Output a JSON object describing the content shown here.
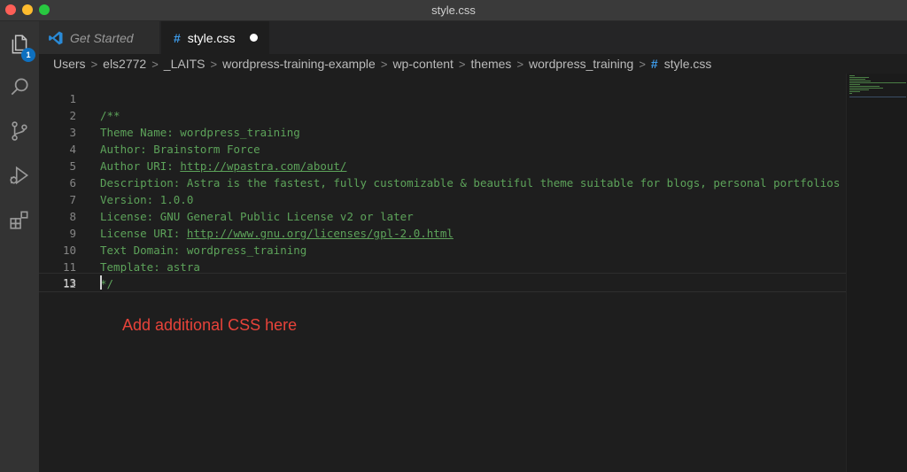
{
  "window": {
    "title": "style.css"
  },
  "activity_bar": {
    "explorer_badge": "1",
    "items": [
      {
        "icon": "files-icon"
      },
      {
        "icon": "search-icon"
      },
      {
        "icon": "source-control-icon"
      },
      {
        "icon": "run-debug-icon"
      },
      {
        "icon": "extensions-icon"
      }
    ]
  },
  "tabs": [
    {
      "label": "Get Started",
      "icon": "vscode-logo-icon",
      "active": false
    },
    {
      "label": "style.css",
      "icon": "css-hash-icon",
      "active": true,
      "modified": true
    }
  ],
  "breadcrumb": {
    "items": [
      "Users",
      "els2772",
      "_LAITS",
      "wordpress-training-example",
      "wp-content",
      "themes",
      "wordpress_training"
    ],
    "file": "style.css"
  },
  "editor": {
    "lines": [
      {
        "num": "1",
        "text": "/**"
      },
      {
        "num": "2",
        "text": "Theme Name: wordpress_training"
      },
      {
        "num": "3",
        "text": "Author: Brainstorm Force"
      },
      {
        "num": "4",
        "prefix": "Author URI: ",
        "link": "http://wpastra.com/about/"
      },
      {
        "num": "5",
        "text": "Description: Astra is the fastest, fully customizable & beautiful theme suitable for blogs, personal portfolios"
      },
      {
        "num": "6",
        "text": "Version: 1.0.0"
      },
      {
        "num": "7",
        "text": "License: GNU General Public License v2 or later"
      },
      {
        "num": "8",
        "prefix": "License URI: ",
        "link": "http://www.gnu.org/licenses/gpl-2.0.html"
      },
      {
        "num": "9",
        "text": "Text Domain: wordpress_training"
      },
      {
        "num": "10",
        "text": "Template: astra"
      },
      {
        "num": "11",
        "text": "*/"
      },
      {
        "num": "12",
        "text": ""
      },
      {
        "num": "13",
        "text": ""
      }
    ],
    "current_line": "13"
  },
  "annotation": {
    "text": "Add additional CSS here",
    "color": "#e8433a"
  },
  "colors": {
    "comment": "#5da35a",
    "accent": "#3d9be9",
    "badge": "#0e70c0"
  }
}
